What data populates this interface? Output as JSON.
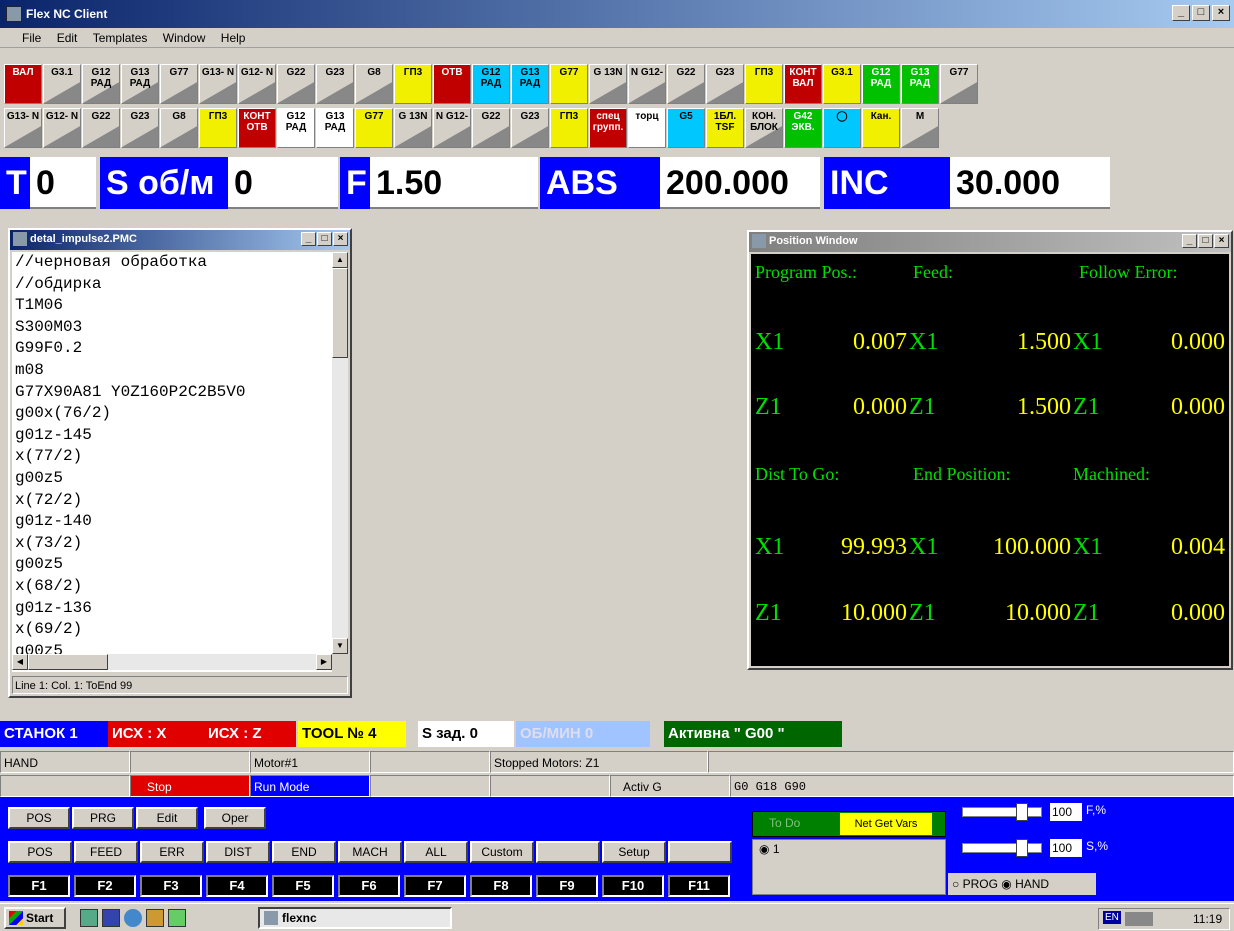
{
  "window": {
    "title": "Flex NC Client",
    "minimize": "_",
    "maximize": "□",
    "close": "×"
  },
  "menu": [
    "File",
    "Edit",
    "Templates",
    "Window",
    "Help"
  ],
  "toolbar1": [
    {
      "label": "ВАЛ",
      "style": "r"
    },
    {
      "label": "G3.1",
      "style": ""
    },
    {
      "label": "G12 РАД",
      "style": ""
    },
    {
      "label": "G13 РАД",
      "style": ""
    },
    {
      "label": "G77",
      "style": ""
    },
    {
      "label": "G13- N",
      "style": ""
    },
    {
      "label": "G12- N",
      "style": ""
    },
    {
      "label": "G22",
      "style": ""
    },
    {
      "label": "G23",
      "style": ""
    },
    {
      "label": "G8",
      "style": ""
    },
    {
      "label": "ГП3",
      "style": "y"
    },
    {
      "label": "ОТВ",
      "style": "r"
    },
    {
      "label": "G12 РАД",
      "style": "c"
    },
    {
      "label": "G13 РАД",
      "style": "c"
    },
    {
      "label": "G77",
      "style": "y"
    },
    {
      "label": "G 13N",
      "style": ""
    },
    {
      "label": "N G12-",
      "style": ""
    },
    {
      "label": "G22",
      "style": ""
    },
    {
      "label": "G23",
      "style": ""
    },
    {
      "label": "ГП3",
      "style": "y"
    },
    {
      "label": "КОНТ ВАЛ",
      "style": "r"
    },
    {
      "label": "G3.1",
      "style": "y"
    },
    {
      "label": "G12 РАД",
      "style": "g"
    },
    {
      "label": "G13 РАД",
      "style": "g"
    },
    {
      "label": "G77",
      "style": ""
    }
  ],
  "toolbar2": [
    {
      "label": "G13- N",
      "style": ""
    },
    {
      "label": "G12- N",
      "style": ""
    },
    {
      "label": "G22",
      "style": ""
    },
    {
      "label": "G23",
      "style": ""
    },
    {
      "label": "G8",
      "style": ""
    },
    {
      "label": "ГП3",
      "style": "y"
    },
    {
      "label": "КОНТ ОТВ",
      "style": "r"
    },
    {
      "label": "G12 РАД",
      "style": "w"
    },
    {
      "label": "G13 РАД",
      "style": "w"
    },
    {
      "label": "G77",
      "style": "y"
    },
    {
      "label": "G 13N",
      "style": ""
    },
    {
      "label": "N G12-",
      "style": ""
    },
    {
      "label": "G22",
      "style": ""
    },
    {
      "label": "G23",
      "style": ""
    },
    {
      "label": "ГП3",
      "style": "y"
    },
    {
      "label": "спец групп.",
      "style": "r"
    },
    {
      "label": "торц",
      "style": "w"
    },
    {
      "label": "G5",
      "style": "c"
    },
    {
      "label": "1БЛ. TSF",
      "style": "y"
    },
    {
      "label": "КОН. БЛОК",
      "style": ""
    },
    {
      "label": "G42 ЭКВ.",
      "style": "g"
    },
    {
      "label": "◯",
      "style": "c"
    },
    {
      "label": "Кан.",
      "style": "y"
    },
    {
      "label": "M",
      "style": ""
    }
  ],
  "bigstatus": {
    "t_label": "T",
    "t_value": "0",
    "s_label": "S об/м",
    "s_value": "0",
    "f_label": "F",
    "f_value": "1.50",
    "abs_label": "ABS",
    "abs_value": "200.000",
    "inc_label": "INC",
    "inc_value": "30.000"
  },
  "editor": {
    "title": "detal_impulse2.PMC",
    "lines": [
      "//черновая обработка",
      "//обдирка",
      "T1M06",
      "S300M03",
      "G99F0.2",
      "m08",
      "G77X90A81 Y0Z160P2C2B5V0",
      "g00x(76/2)",
      "g01z-145",
      "x(77/2)",
      "g00z5",
      "x(72/2)",
      "g01z-140",
      "x(73/2)",
      "g00z5",
      "x(68/2)",
      "g01z-136",
      "x(69/2)",
      "g00z5"
    ],
    "status": "Line 1: Col. 1: ToEnd 99"
  },
  "position": {
    "title": "Position Window",
    "headers": [
      "Program Pos.:",
      "Feed:",
      "Follow Error:"
    ],
    "headers2": [
      "Dist To Go:",
      "End Position:",
      "Machined:"
    ],
    "rows1": [
      {
        "axis": "X1",
        "v1": "0.007",
        "v2": "1.500",
        "v3": "0.000"
      },
      {
        "axis": "Z1",
        "v1": "0.000",
        "v2": "1.500",
        "v3": "0.000"
      }
    ],
    "rows2": [
      {
        "axis": "X1",
        "v1": "99.993",
        "v2": "100.000",
        "v3": "0.004"
      },
      {
        "axis": "Z1",
        "v1": "10.000",
        "v2": "10.000",
        "v3": "0.000"
      }
    ]
  },
  "statusbar": {
    "machine": "СТАНОК 1",
    "isx_x": "ИСХ : X",
    "isx_z": "ИСХ : Z",
    "tool": "TOOL № 4",
    "s_set": "S зад. 0",
    "rpm": "ОБ/МИН 0",
    "active": "Активна \" G00 \""
  },
  "row2": {
    "mode": "HAND",
    "motor": "Motor#1",
    "stopped": "Stopped Motors: Z1"
  },
  "row3": {
    "stop": "Stop",
    "run": "Run Mode",
    "activ": "Activ G",
    "gcodes": "G0 G18 G90"
  },
  "panel": {
    "tabs": [
      "POS",
      "PRG",
      "Edit",
      "Oper"
    ],
    "views": [
      "POS",
      "FEED",
      "ERR",
      "DIST",
      "END",
      "MACH",
      "ALL",
      "Custom",
      "",
      "Setup",
      ""
    ],
    "fkeys": [
      "F1",
      "F2",
      "F3",
      "F4",
      "F5",
      "F6",
      "F7",
      "F8",
      "F9",
      "F10",
      "F11"
    ],
    "todo": "To Do",
    "netvars": "Net Get Vars",
    "radio1": "1",
    "f_value": "100",
    "f_label": "F,%",
    "s_value": "100",
    "s_label": "S,%",
    "prog": "PROG",
    "hand": "HAND"
  },
  "taskbar": {
    "start": "Start",
    "app": "flexnc",
    "lang": "EN",
    "time": "11:19"
  }
}
